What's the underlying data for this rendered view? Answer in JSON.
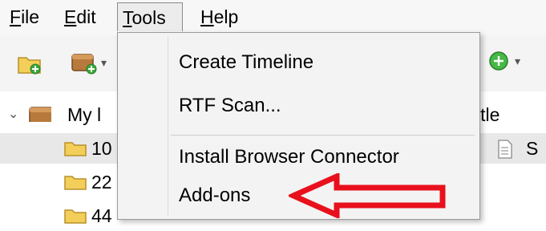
{
  "menubar": {
    "items": [
      {
        "label_accel": "F",
        "label_rest": "ile"
      },
      {
        "label_accel": "E",
        "label_rest": "dit"
      },
      {
        "label_accel": "T",
        "label_rest": "ools"
      },
      {
        "label_accel": "H",
        "label_rest": "elp"
      }
    ]
  },
  "toolbar": {
    "icons": [
      "new-collection-icon",
      "new-group-icon",
      "add-item-icon"
    ]
  },
  "tree": {
    "root_label": "My l",
    "column_header": "itle",
    "rows": [
      {
        "label": "10"
      },
      {
        "label": "22"
      },
      {
        "label": "44"
      }
    ],
    "item_preview": "S"
  },
  "tools_menu": {
    "items": [
      {
        "label": "Create Timeline"
      },
      {
        "label": "RTF Scan..."
      },
      {
        "label": "Install Browser Connector"
      },
      {
        "label": "Add-ons"
      }
    ]
  },
  "annotation": {
    "color": "#e8101c"
  }
}
